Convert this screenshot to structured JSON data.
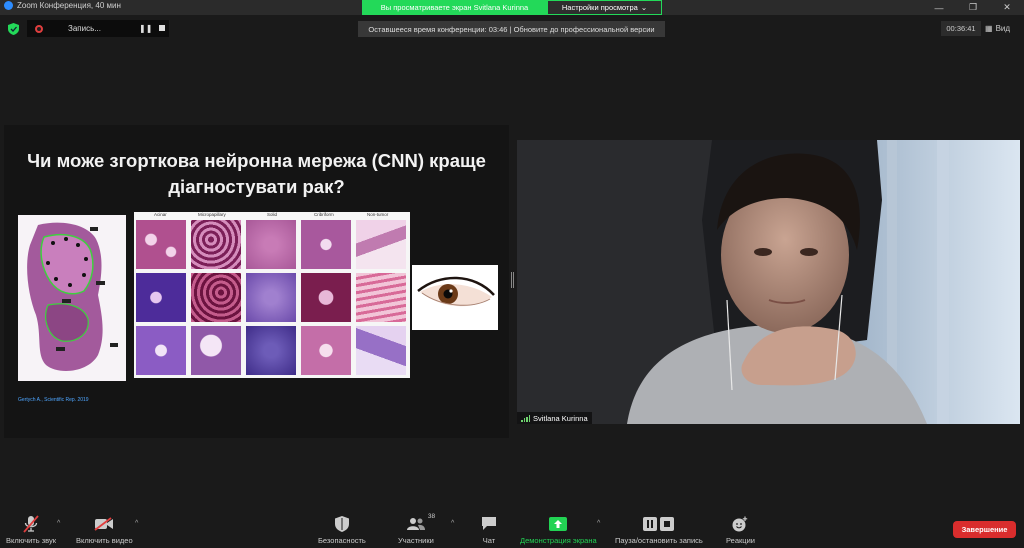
{
  "window": {
    "title": "Zoom Конференция, 40 мин",
    "share_banner": "Вы просматриваете экран Svitlana Kurinna",
    "view_settings": "Настройки просмотра"
  },
  "recording": {
    "label": "Запись..."
  },
  "meeting": {
    "time_notice": "Оставшееся время конференции: 03:46 | Обновите до профессиональной версии",
    "elapsed": "00:36:41",
    "view_label": "Вид"
  },
  "slide": {
    "title_line1": "Чи може згорткова нейронна мережа (CNN) краще",
    "title_line2": "діагностувати рак?",
    "columns": [
      "Acinar",
      "Micropapillary",
      "Solid",
      "Cribriform",
      "Non-tumor"
    ],
    "citation": "Gertych A., Scientific Rep. 2019"
  },
  "video": {
    "participant_name": "Svitlana Kurinna"
  },
  "toolbar": {
    "unmute": "Включить звук",
    "start_video": "Включить видео",
    "security": "Безопасность",
    "participants": "Участники",
    "participants_count": "38",
    "chat": "Чат",
    "share_screen": "Демонстрация экрана",
    "pause_recording": "Пауза/остановить запись",
    "reactions": "Реакции",
    "end": "Завершение"
  },
  "colors": {
    "share_green": "#23d959",
    "end_red": "#d92d2d",
    "record_red": "#e03e3e",
    "citation_blue": "#4fa6ff"
  }
}
